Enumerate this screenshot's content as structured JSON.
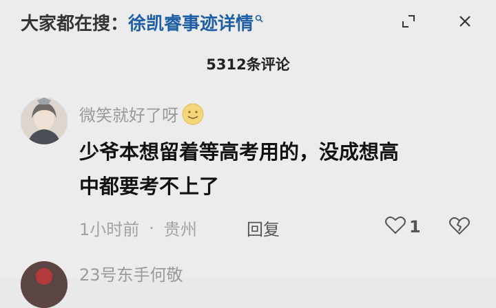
{
  "header": {
    "search_prefix": "大家都在搜：",
    "search_query": "徐凯睿事迹详情",
    "search_icon": "search-icon",
    "expand_icon": "expand-icon",
    "close_icon": "close-icon"
  },
  "comments_count_label": "5312条评论",
  "comments": [
    {
      "username": "微笑就好了呀",
      "text_line1": "少爷本想留着等高考用的，没成想高",
      "text_line2": "中都要考不上了",
      "time": "1小时前",
      "separator": "·",
      "location": "贵州",
      "reply_label": "回复",
      "likes": "1"
    },
    {
      "username": "23号东手何敬"
    }
  ]
}
